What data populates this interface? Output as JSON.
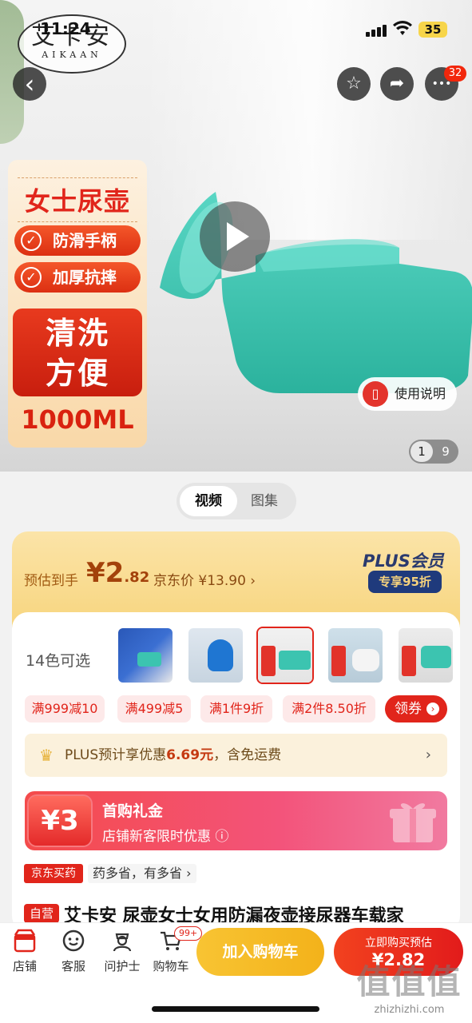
{
  "status": {
    "time": "11:24",
    "battery": "35"
  },
  "brand": {
    "logo_cn": "艾卡安",
    "logo_en": "AIKAAN"
  },
  "nav": {
    "back_icon": "‹",
    "star_icon": "☆",
    "share_icon": "➦",
    "more_icon": "•••",
    "notif_count": "32"
  },
  "promo": {
    "title": "女士尿壶",
    "feature1": "防滑手柄",
    "feature2": "加厚抗摔",
    "highlight": "清洗方便",
    "volume": "1000ML"
  },
  "media": {
    "manual_label": "使用说明",
    "page_current": "1",
    "page_total": "9"
  },
  "media_tabs": [
    {
      "label": "视频"
    },
    {
      "label": "图集"
    }
  ],
  "price": {
    "est_label": "预估到手",
    "est_value_main": "¥2",
    "est_value_dec": ".82",
    "jd_price": "京东价 ¥13.90 ›",
    "plus_label": "PLUS会员",
    "plus_discount": "专享95折"
  },
  "colors": {
    "label": "14色可选",
    "thumbs": [
      "thumb1",
      "thumb2",
      "thumb3",
      "thumb4",
      "thumb5"
    ]
  },
  "coupons": [
    {
      "label": "满999减10"
    },
    {
      "label": "满499减5"
    },
    {
      "label": "满1件9折"
    },
    {
      "label": "满2件8.50折"
    }
  ],
  "get_coupon": "领券",
  "plus_bar": {
    "prefix": "PLUS预计享优惠",
    "amount": "6.69元",
    "suffix": "，含免运费",
    "chevron": "›"
  },
  "gift": {
    "amount": "¥3",
    "title": "首购礼金",
    "subtitle": "店铺新客限时优惠 ⓘ"
  },
  "tags": {
    "jd_pharmacy": "京东买药",
    "drug_slogan": "药多省，有多省 ›",
    "self_run": "自营"
  },
  "product": {
    "title": "艾卡安 尿壶女士女用防漏夜壶接尿器车载家"
  },
  "bottom_bar": {
    "items": [
      {
        "label": "店铺",
        "icon": "store-icon"
      },
      {
        "label": "客服",
        "icon": "service-icon"
      },
      {
        "label": "问护士",
        "icon": "nurse-icon"
      },
      {
        "label": "购物车",
        "icon": "cart-icon"
      }
    ],
    "cart_badge": "99+",
    "add_cart": "加入购物车",
    "buy_now_l1": "立即购买预估",
    "buy_now_l2": "¥2.82"
  },
  "watermark": {
    "line1": "值值值",
    "line2": "zhizhizhi.com"
  },
  "colors_theme": {
    "jd_red": "#e1251b",
    "teal_product": "#3cc4b0",
    "gold": "#f3c458"
  }
}
